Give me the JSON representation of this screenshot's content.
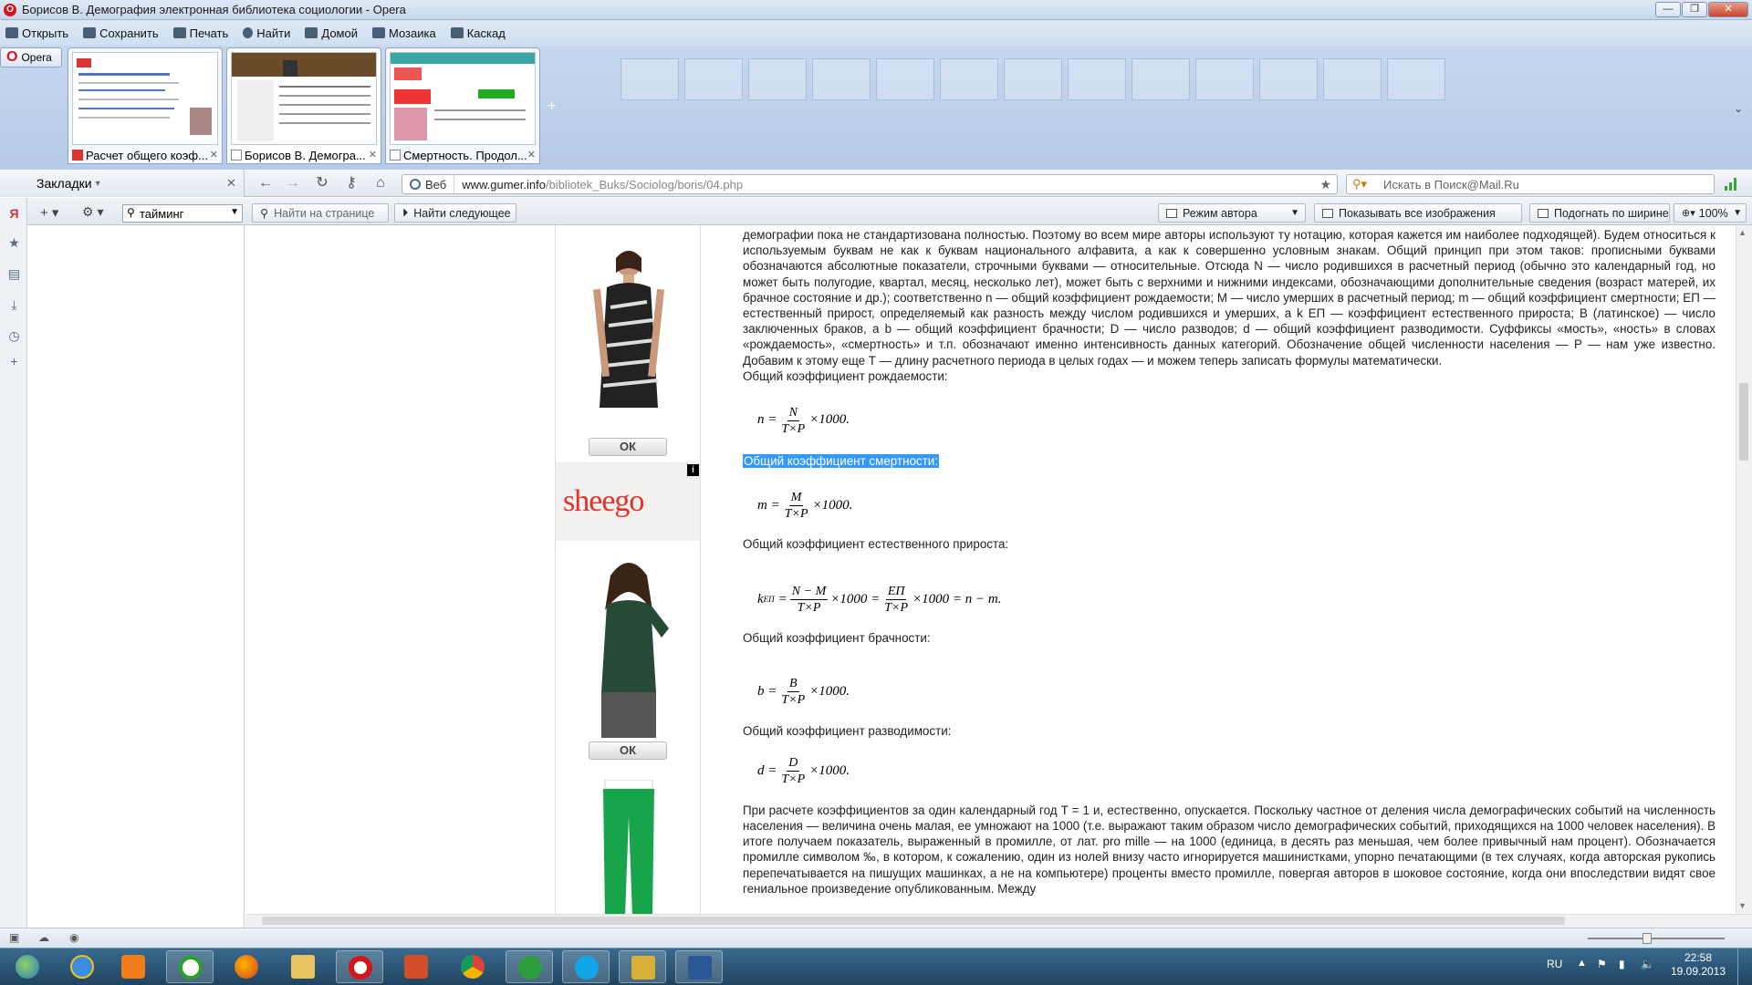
{
  "window": {
    "title": "Борисов В. Демография электронная библиотека социологии - Opera",
    "controls": [
      "—",
      "❐",
      "✕"
    ]
  },
  "menubar": [
    "Открыть",
    "Сохранить",
    "Печать",
    "Найти",
    "Домой",
    "Мозаика",
    "Каскад"
  ],
  "opera_button": "Opera",
  "tabs": [
    {
      "label": "Расчет общего коэф...",
      "close": "✕",
      "active": false
    },
    {
      "label": "Борисов В. Демогра...",
      "close": "✕",
      "active": true
    },
    {
      "label": "Смертность. Продол...",
      "close": "✕",
      "active": false
    }
  ],
  "tab_add": "+",
  "sidebar": {
    "header": "Закладки",
    "close": "✕",
    "search_value": "тайминг"
  },
  "address": {
    "web_label": "Веб",
    "url_domain": "www.gumer.info",
    "url_path": "/bibliotek_Buks/Sociolog/boris/04.php",
    "search_placeholder": "Искать в Поиск@Mail.Ru"
  },
  "findbar": {
    "find_placeholder": "Найти на странице",
    "find_next": "Найти следующее",
    "author_mode": "Режим автора",
    "show_images": "Показывать все изображения",
    "fit_width": "Подогнать по ширине",
    "zoom": "100%"
  },
  "ads": {
    "ok1": "ОК",
    "brand": "sheego",
    "info": "i",
    "ok2": "ОК"
  },
  "article": {
    "para1": "демографии пока не стандартизована полностью. Поэтому во всем мире авторы используют ту нотацию, которая кажется им наиболее подходящей). Будем относиться к используемым буквам не как к буквам национального алфавита, а как к совершенно условным знакам. Общий принцип при этом таков: прописными буквами обозначаются абсолютные показатели, строчными буквами — относительные. Отсюда N — число родившихся в расчетный период (обычно это календарный год, но может быть полугодие, квартал, месяц, несколько лет), может быть с верхними и нижними индексами, обозначающими дополнительные сведения (возраст матерей, их брачное состояние и др.); соответственно n — общий коэффициент рождаемости; M — число умерших в расчетный период; m — общий коэффициент смертности; ЕП — естественный прирост, определяемый как разность между числом родившихся и умерших, а k ЕП — коэффициент естественного прироста; B (латинское) — число заключенных браков, а b — общий коэффициент брачности; D — число разводов; d — общий коэффициент разводимости. Суффиксы «мость», «ность» в словах «рождаемость», «смертность» и т.п. обозначают именно интенсивность данных категорий. Обозначение общей численности населения — P — нам уже известно. Добавим к этому еще T — длину расчетного периода в целых годах — и можем теперь записать формулы математически.",
    "h_birth": "Общий коэффициент рождаемости:",
    "h_death": "Общий коэффициент смертности:",
    "h_natural": "Общий коэффициент естественного прироста:",
    "h_marriage": "Общий коэффициент брачности:",
    "h_divorce": "Общий коэффициент разводимости:",
    "para_last": "При расчете коэффициентов за один календарный год T = 1 и, естественно, опускается. Поскольку частное от деления числа демографических событий на численность населения — величина очень малая, ее умножают на 1000 (т.е. выражают таким образом число демографических событий, приходящихся на 1000 человек населения). В итоге получаем показатель, выраженный в промилле, от лат. pro mille — на 1000 (единица, в десять раз меньшая, чем более привычный нам процент). Обозначается промилле символом ‰, в котором, к сожалению, один из нолей внизу часто игнорируется машинистками, упорно печатающими (в тех случаях, когда авторская рукопись перепечатывается на пишущих машинках, а не на компьютере) проценты вместо промилле, повергая авторов в шоковое состояние, когда они впоследствии видят свое гениальное произведение опубликованным. Между"
  },
  "formulas": {
    "birth": {
      "lhs": "n =",
      "num": "N",
      "den": "T×P",
      "tail": "×1000."
    },
    "death": {
      "lhs": "m =",
      "num": "M",
      "den": "T×P",
      "tail": "×1000."
    },
    "natural": {
      "lhs": "k",
      "sup": "ЕП",
      "eq": "=",
      "num1": "N − M",
      "den1": "T×P",
      "mid": "×1000 =",
      "num2": "ЕП",
      "den2": "T×P",
      "tail": "×1000 = n − m."
    },
    "marriage": {
      "lhs": "b =",
      "num": "B",
      "den": "T×P",
      "tail": "×1000."
    },
    "divorce": {
      "lhs": "d =",
      "num": "D",
      "den": "T×P",
      "tail": "×1000."
    }
  },
  "taskbar": {
    "lang": "RU",
    "time": "22:58",
    "date": "19.09.2013"
  },
  "colors": {
    "selection": "#3399ff",
    "sheego": "#e2332b",
    "opera_red": "#d4161c"
  }
}
